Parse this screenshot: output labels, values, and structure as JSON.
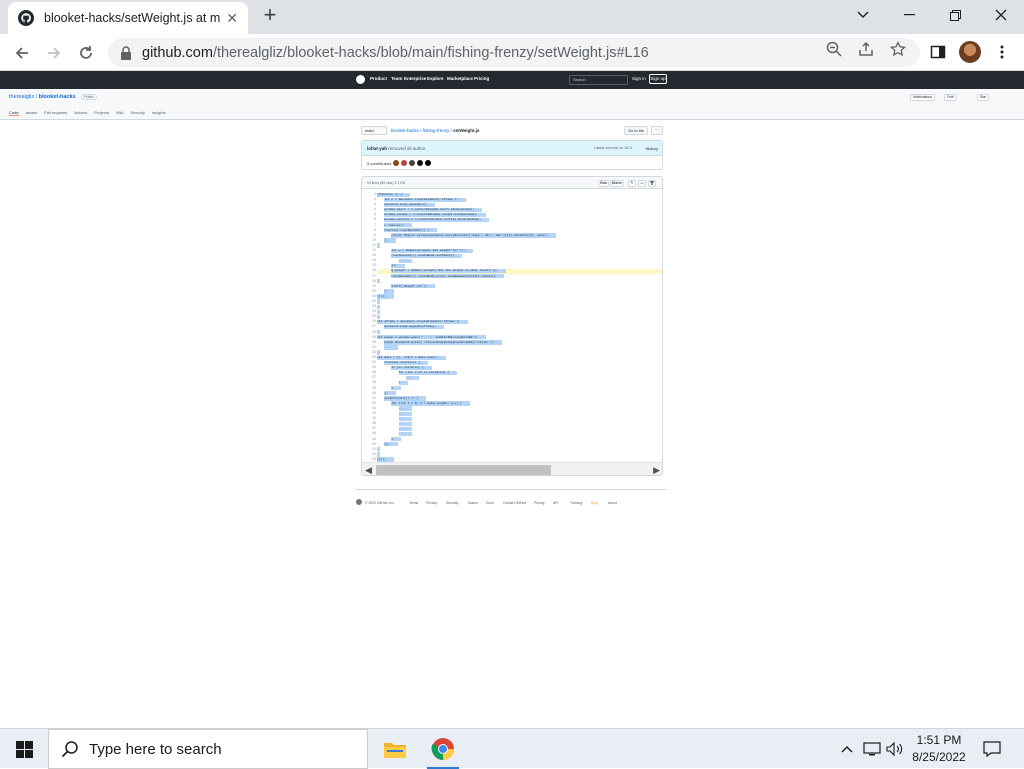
{
  "browser": {
    "tab_title": "blooket-hacks/setWeight.js at ma",
    "url_domain": "github.com",
    "url_path": "/therealgliz/blooket-hacks/blob/main/fishing-frenzy/setWeight.js#L16",
    "new_tab": "+",
    "tab_close": "✕"
  },
  "github": {
    "nav": [
      "Product",
      "Team",
      "Enterprise",
      "Explore",
      "Marketplace",
      "Pricing"
    ],
    "search_placeholder": "Search",
    "sign_in": "Sign in",
    "sign_up": "Sign up",
    "repo_owner": "therealgliz",
    "repo_sep": " / ",
    "repo_name": "blooket-hacks",
    "repo_badge": "Public",
    "repo_tabs": [
      "Code",
      "Issues",
      "Pull requests",
      "Actions",
      "Projects",
      "Wiki",
      "Security",
      "Insights"
    ],
    "repo_actions": [
      "Notifications",
      "Fork",
      "Star"
    ],
    "branch": "main",
    "breadcrumb_repo": "blooket-hacks",
    "breadcrumb_dir": "fishing-frenzy",
    "breadcrumb_file": "setWeight.js",
    "goto_file": "Go to file",
    "more": "···",
    "commit_author": "lofiat-yah",
    "commit_message": "removed all author",
    "commit_latest": "Latest commit on Jul 3",
    "history": "History",
    "contributors": "5 contributors",
    "file_meta": "94 lines (89 sloc)   3.1 KB",
    "raw": "Raw",
    "blame": "Blame"
  },
  "code": {
    "line_count": 54,
    "highlight_line": 16,
    "lines": [
      "(function () {",
      "    let n = document.createElement('iframe');",
      "    document.body.append(n);",
      "    window.alert = n.contentWindow.alert.bind(window);",
      "    window.prompt = n.contentWindow.prompt.bind(window);",
      "    window.confirm = n.contentWindow.confirm.bind(window);",
      "    n.remove();",
      "    function reactHandler() {",
      "        return Object.values(document.querySelector('#app > div > div'))[1].children[1]._owner;",
      "    };",
      "",
      "        let w = Number(prompt(`Set weight to?`));",
      "        reactHandler().stateNode.setState({",
      "            ...",
      "        });",
      "        Q.weight = Number(prompt(`Set the weight to what level?`));",
      "        reactHandler().stateNode.props.liveGameController.setVal({",
      "",
      "        alert(`Weight set`);",
      "    }",
      "})();",
      "",
      "",
      "",
      "",
      "let iframe = document.createElement('iframe');",
      "    document.body.append(iframe);",
      "",
      "let popup = window.open('', '', 'width=350,height=400');",
      "    popup.document.write(`<style>body{background:#222}</style>`);",
      "    ...",
      "",
      "let data = [], start = Date.now();",
      "    function check(el) {",
      "        if (el.children) {",
      "            for (let c of el.children) {",
      "                ...",
      "            }",
      "        }",
      "    };",
      "    setInterval(() => {",
      "        for (let i = 0; i < data.length; i++) {",
      "            ...",
      "            ...",
      "            ...",
      "            ...",
      "            ...",
      "            ...",
      "        }",
      "    });",
      "",
      "",
      "})();",
      ""
    ]
  },
  "footer": {
    "copyright": "© 2022 GitHub, Inc.",
    "links": [
      "Terms",
      "Privacy",
      "Security",
      "Status",
      "Docs",
      "Contact GitHub",
      "Pricing",
      "API",
      "Training",
      "Blog",
      "About"
    ]
  },
  "taskbar": {
    "search_placeholder": "Type here to search",
    "time": "1:51 PM",
    "date": "8/25/2022"
  }
}
